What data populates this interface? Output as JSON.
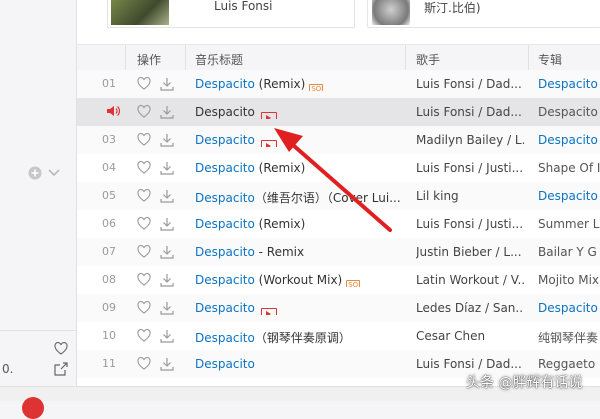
{
  "sidebar": {
    "bottom_left_text": "0.",
    "icons": [
      "add-circle-icon",
      "chevron-down-icon",
      "heart-icon",
      "share-icon"
    ]
  },
  "top_cards": [
    {
      "label": "Luis Fonsi"
    },
    {
      "label": "斯汀.比伯)"
    }
  ],
  "table": {
    "headers": {
      "ops": "操作",
      "title": "音乐标题",
      "artist": "歌手",
      "album": "专辑"
    },
    "rows": [
      {
        "idx": "01",
        "title": "Despacito",
        "rest": " (Remix)",
        "badge": "sq",
        "artist": "Luis Fonsi / Dad...",
        "album": "Despacito",
        "album_link": true
      },
      {
        "idx": "",
        "title": "Despacito",
        "rest": "",
        "badge": "mv",
        "artist": "Luis Fonsi / Dad...",
        "album": "Despacito",
        "album_link": false,
        "playing": true
      },
      {
        "idx": "03",
        "title": "Despacito",
        "rest": "",
        "badge": "mv",
        "artist": "Madilyn Bailey / L...",
        "album": "Despacito",
        "album_link": true
      },
      {
        "idx": "04",
        "title": "Despacito",
        "rest": " (Remix)",
        "badge": "",
        "artist": "Luis Fonsi / Justi...",
        "album": "Shape Of I",
        "album_link": false
      },
      {
        "idx": "05",
        "title": "Despacito",
        "rest": "（维吾尔语）（Cover Lui...",
        "badge": "",
        "artist": "Lil king",
        "album": "Despacito",
        "album_link": true
      },
      {
        "idx": "06",
        "title": "Despacito",
        "rest": " (Remix)",
        "badge": "",
        "artist": "Luis Fonsi / Justi...",
        "album": "Summer L",
        "album_link": false
      },
      {
        "idx": "07",
        "title": "Despacito",
        "rest": " - Remix",
        "badge": "",
        "artist": "Justin Bieber / L...",
        "album": "Bailar Y G",
        "album_link": false
      },
      {
        "idx": "08",
        "title": "Despacito",
        "rest": " (Workout Mix)",
        "badge": "sq",
        "artist": "Latin Workout / V...",
        "album": "Mojito Mix",
        "album_link": false
      },
      {
        "idx": "09",
        "title": "Despacito",
        "rest": "",
        "badge": "mv",
        "artist": "Ledes Díaz / San...",
        "album": "Despacito",
        "album_link": true
      },
      {
        "idx": "10",
        "title": "Despacito",
        "rest": "（钢琴伴奏原调）",
        "badge": "",
        "artist": "Cesar Chen",
        "album": "纯钢琴伴奏",
        "album_link": false
      },
      {
        "idx": "11",
        "title": "Despacito",
        "rest": "",
        "badge": "",
        "artist": "Luis Fonsi / Dad...",
        "album": "Reggaeto",
        "album_link": false
      }
    ]
  },
  "badges": {
    "sq": "SQ"
  },
  "watermark": "头条 @胖辉有话说",
  "colors": {
    "link": "#0c73c2",
    "accent_red": "#d33",
    "arrow": "#e02020",
    "selected_row": "#e5e5e8"
  }
}
